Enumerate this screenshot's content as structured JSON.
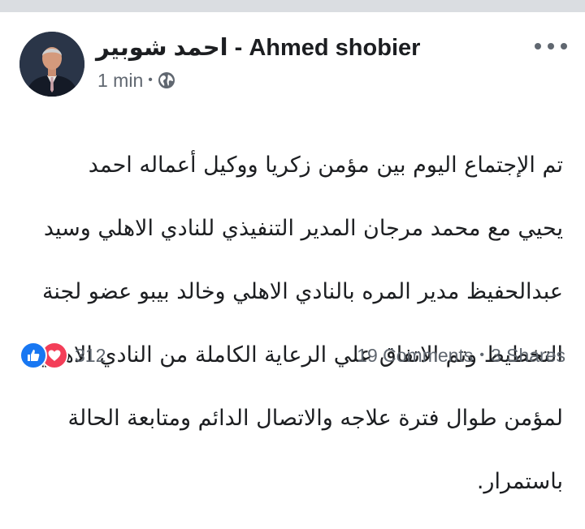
{
  "post": {
    "author": "احمد شوبير - Ahmed shobier",
    "time": "1 min",
    "separator": "•",
    "privacy_icon": "globe-icon",
    "menu_icon": "more-horizontal-icon",
    "body_lines": [
      "تم الإجتماع اليوم بين مؤمن زكريا ووكيل أعماله احمد",
      "يحيي مع محمد مرجان المدير التنفيذي للنادي الاهلي وسيد",
      "عبدالحفيظ مدير المره بالنادي الاهلي وخالد بيبو عضو لجنة",
      "التخطيط وتم الاتفاق علي الرعاية الكاملة من النادي الاهلي",
      "لمؤمن طوال فترة علاجه والاتصال الدائم ومتابعة الحالة",
      "باستمرار."
    ]
  },
  "footer": {
    "reaction_count": "312",
    "reaction_icons": [
      "like-icon",
      "love-icon"
    ],
    "comments": "19 Comments",
    "separator": "•",
    "shares": "3 Shares"
  },
  "colors": {
    "text": "#1c1e21",
    "secondary": "#606770",
    "like": "#1877f2",
    "love": "#f33e58",
    "top_bar": "#dadde1"
  }
}
